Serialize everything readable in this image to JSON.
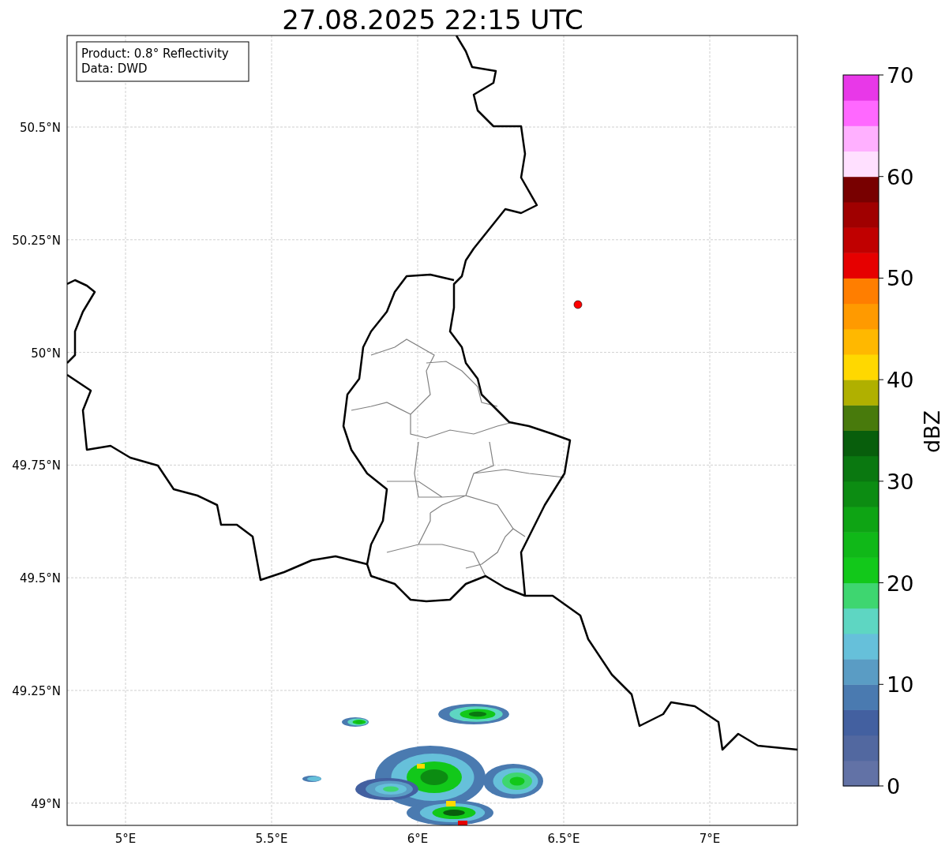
{
  "title": "27.08.2025 22:15 UTC",
  "info_box": {
    "lines": [
      "Product: 0.8° Reflectivity",
      "Data: DWD"
    ]
  },
  "map": {
    "x_ticks": [
      "5°E",
      "5.5°E",
      "6°E",
      "6.5°E",
      "7°E"
    ],
    "y_ticks": [
      "50.5°N",
      "50.25°N",
      "50°N",
      "49.75°N",
      "49.5°N",
      "49.25°N",
      "49°N"
    ]
  },
  "colorbar": {
    "label": "dBZ",
    "ticks": [
      "70",
      "60",
      "50",
      "40",
      "30",
      "20",
      "10",
      "0"
    ],
    "bands": [
      {
        "color": "#6272a6"
      },
      {
        "color": "#5268a0"
      },
      {
        "color": "#4360a0"
      },
      {
        "color": "#4a7ab0"
      },
      {
        "color": "#5a9cc4"
      },
      {
        "color": "#66c0da"
      },
      {
        "color": "#5ed6c2"
      },
      {
        "color": "#3ed670"
      },
      {
        "color": "#12c81a"
      },
      {
        "color": "#10b818"
      },
      {
        "color": "#0ea414"
      },
      {
        "color": "#0c8c12"
      },
      {
        "color": "#0a7810"
      },
      {
        "color": "#085e0c"
      },
      {
        "color": "#487a0c"
      },
      {
        "color": "#b0b000"
      },
      {
        "color": "#ffd800"
      },
      {
        "color": "#ffb800"
      },
      {
        "color": "#ff9a00"
      },
      {
        "color": "#ff7e00"
      },
      {
        "color": "#e60000"
      },
      {
        "color": "#c00000"
      },
      {
        "color": "#a00000"
      },
      {
        "color": "#780000"
      },
      {
        "color": "#ffe0ff"
      },
      {
        "color": "#ffb0ff"
      },
      {
        "color": "#ff68ff"
      },
      {
        "color": "#e838e8"
      }
    ]
  }
}
